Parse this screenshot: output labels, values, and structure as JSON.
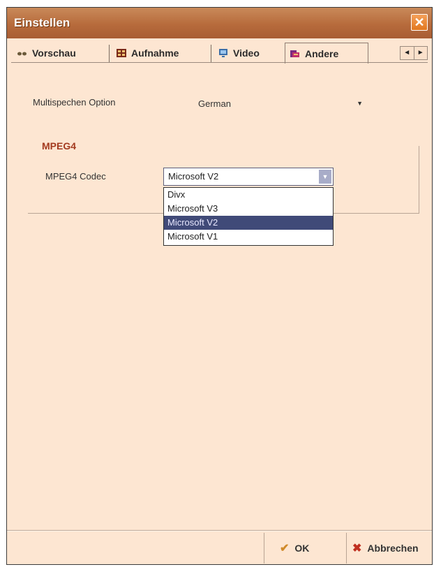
{
  "window": {
    "title": "Einstellen",
    "close_glyph": "✕"
  },
  "tabs": [
    {
      "label": "Vorschau",
      "icon": "eye-icon"
    },
    {
      "label": "Aufnahme",
      "icon": "film-icon"
    },
    {
      "label": "Video",
      "icon": "monitor-icon"
    },
    {
      "label": "Andere",
      "icon": "folder-icon",
      "active": true
    }
  ],
  "tab_scroll": {
    "left": "◄",
    "right": "►"
  },
  "multispeech": {
    "label": "Multispechen Option",
    "value": "German",
    "arrow": "▼"
  },
  "mpeg4": {
    "group_title": "MPEG4",
    "codec_label": "MPEG4 Codec",
    "codec_value": "Microsoft V2",
    "arrow": "▼",
    "options": [
      "Divx",
      "Microsoft V3",
      "Microsoft V2",
      "Microsoft V1"
    ],
    "selected_index": 2
  },
  "footer": {
    "ok_label": "OK",
    "cancel_label": "Abbrechen",
    "ok_glyph": "✔",
    "cancel_glyph": "✖"
  },
  "colors": {
    "background": "#fde6d2",
    "title_bar": "#b76b3c",
    "close_button": "#e2781f",
    "group_title": "#a33a1f",
    "selection": "#404a78"
  }
}
